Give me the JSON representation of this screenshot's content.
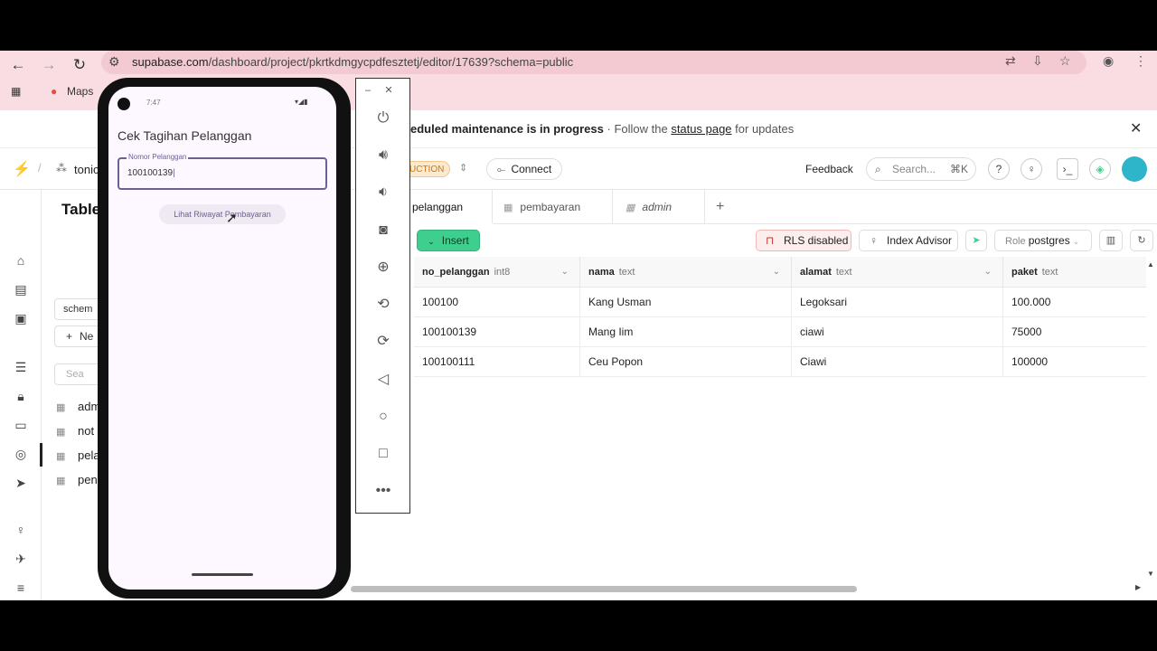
{
  "browser": {
    "url_host": "supabase.com",
    "url_path": "/dashboard/project/pkrtkdmgycpdfesztetj/editor/17639?schema=public",
    "bookmark_maps": "Maps"
  },
  "banner": {
    "bold": "eduled maintenance is in progress",
    "sep": "·",
    "follow": "Follow the",
    "link": "status page",
    "after": "for updates"
  },
  "topnav": {
    "project": "tonic",
    "env_badge": "UCTION",
    "connect": "Connect",
    "feedback": "Feedback",
    "search_placeholder": "Search...",
    "search_kbd": "⌘K"
  },
  "sidebar": {
    "title": "Table",
    "schema": "schem",
    "new": "Ne",
    "search": "Sea",
    "tables": [
      "adm",
      "not",
      "pela",
      "pen"
    ]
  },
  "phone": {
    "time": "7:47",
    "app_title": "Cek Tagihan Pelanggan",
    "input_label": "Nomor Pelanggan",
    "input_value": "100100139",
    "button": "Lihat Riwayat Pembayaran"
  },
  "tabs": [
    "pelanggan",
    "pembayaran",
    "admin"
  ],
  "toolbar": {
    "insert": "Insert",
    "rls": "RLS disabled",
    "advisor": "Index Advisor",
    "role_label": "Role",
    "role_value": "postgres"
  },
  "grid": {
    "columns": [
      {
        "name": "no_pelanggan",
        "type": "int8"
      },
      {
        "name": "nama",
        "type": "text"
      },
      {
        "name": "alamat",
        "type": "text"
      },
      {
        "name": "paket",
        "type": "text"
      }
    ],
    "rows": [
      [
        "100100",
        "Kang Usman",
        "Legoksari",
        "100.000"
      ],
      [
        "100100139",
        "Mang Iim",
        "ciawi",
        "75000"
      ],
      [
        "100100111",
        "Ceu Popon",
        "Ciawi",
        "100000"
      ]
    ]
  },
  "colors": {
    "brand": "#3ecf8e",
    "phone_accent": "#6d5f94",
    "browser_bar": "#f9dde3"
  }
}
